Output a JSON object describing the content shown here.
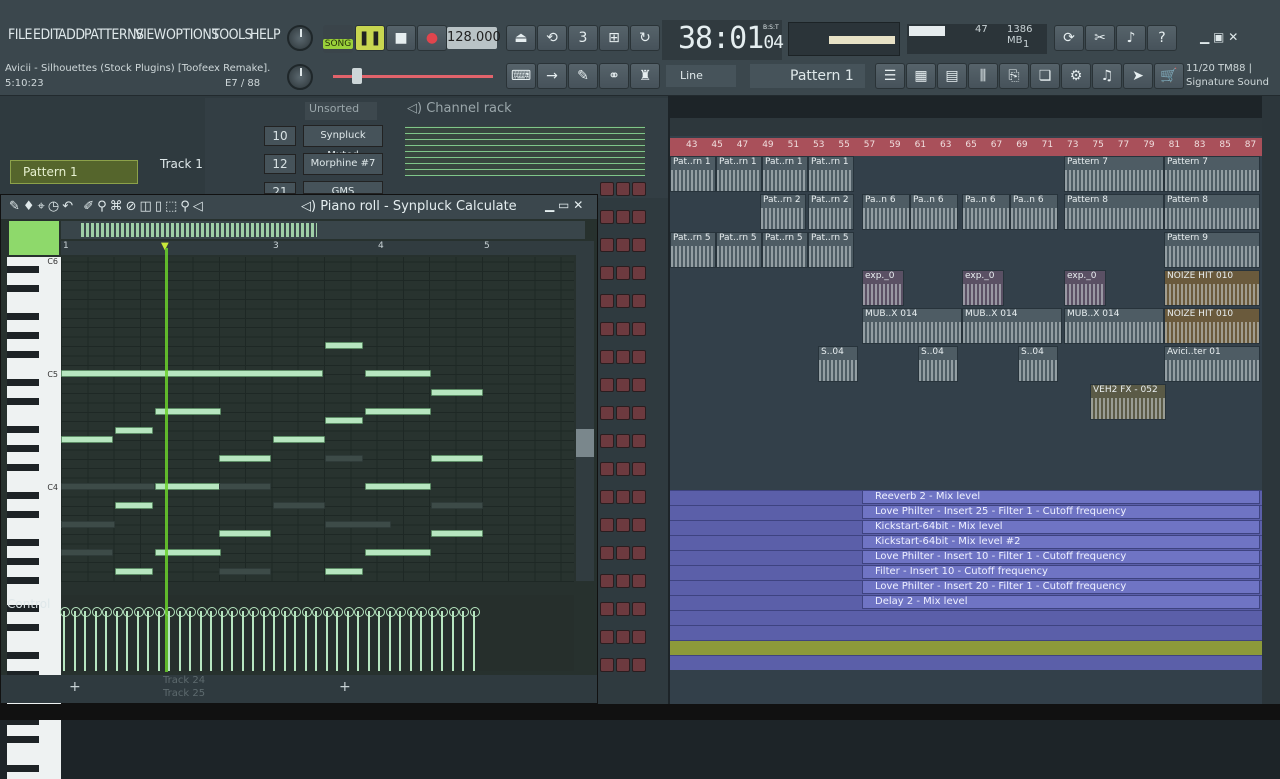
{
  "menu": [
    "FILE",
    "EDIT",
    "ADD",
    "PATTERNS",
    "VIEW",
    "OPTIONS",
    "TOOLS",
    "HELP"
  ],
  "project": {
    "title": "Avicii - Silhouettes (Stock Plugins) [Toofeex Remake].",
    "position": "5:10:23",
    "note_info": "E7 / 88"
  },
  "transport": {
    "mode": "SONG",
    "tempo": "128.000",
    "time": "38:01",
    "time_sub": "04",
    "time_unit": "B:S:T",
    "snap": "Line",
    "pattern": "Pattern 1",
    "cpu": "47",
    "memory": "1386 MB",
    "voices": "1"
  },
  "news": {
    "counter": "11/20",
    "line1": "TM88 |",
    "line2": "Signature Sound"
  },
  "channel_rack": {
    "title": "Channel rack",
    "filter": "Unsorted",
    "channels": [
      {
        "num": "10",
        "name": "Synpluck Muted"
      },
      {
        "num": "12",
        "name": "Morphine #7"
      },
      {
        "num": "21",
        "name": "GMS"
      }
    ]
  },
  "sidebar": {
    "pattern_item": "Pattern 1",
    "track_label": "Track 1"
  },
  "piano_roll": {
    "title": "Piano roll - Synpluck Calculate",
    "bars": [
      "1",
      "3",
      "4",
      "5"
    ],
    "keys": [
      "C6",
      "C5",
      "C4"
    ],
    "control": "Control",
    "track_footer": [
      "Track 24",
      "Track 25"
    ]
  },
  "playlist": {
    "bars": [
      "43",
      "45",
      "47",
      "49",
      "51",
      "53",
      "55",
      "57",
      "59",
      "61",
      "63",
      "65",
      "67",
      "69",
      "71",
      "73",
      "75",
      "77",
      "79",
      "81",
      "83",
      "85",
      "87"
    ],
    "clips": {
      "p1": "Pat..rn 1",
      "p2": "Pat..rn 2",
      "p5": "Pat..rn 5",
      "p6": "Pa..n 6",
      "p7": "Pattern 7",
      "p8": "Pattern 8",
      "p9": "Pattern 9",
      "exp": "exp._0",
      "mub": "MUB..X 014",
      "s04": "S..04",
      "noize": "NOIZE HIT 010",
      "avicii": "Avici..ter 01",
      "veh": "VEH2 FX - 052"
    },
    "automation": [
      "Reeverb 2 - Mix level",
      "Love Philter - Insert 25 - Filter 1 - Cutoff frequency",
      "Kickstart-64bit - Mix level",
      "Kickstart-64bit - Mix level #2",
      "Love Philter - Insert 10 - Filter 1 - Cutoff frequency",
      "Filter - Insert 10 - Cutoff frequency",
      "Love Philter - Insert 20 - Filter 1 - Cutoff frequency",
      "Delay 2 - Mix level"
    ]
  },
  "colors": {
    "note": "#b7e6c0",
    "playhead": "#6bd12c",
    "ruler": "#a9505a",
    "automation": "#6f74c4",
    "record": "#e0454d"
  }
}
